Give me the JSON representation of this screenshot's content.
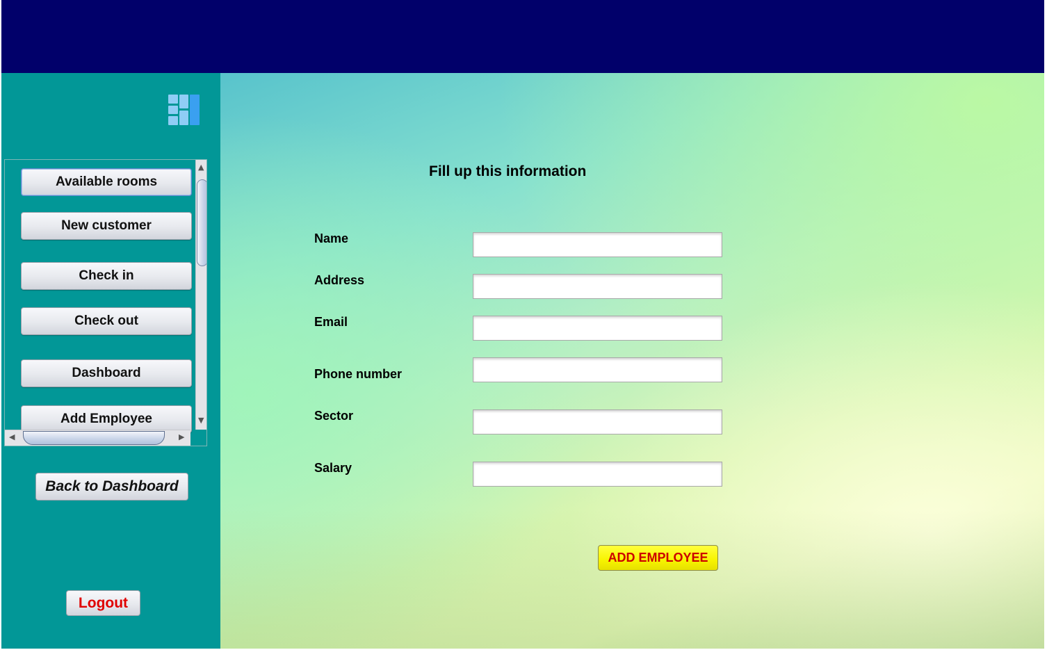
{
  "sidebar": {
    "logo_icon": "dashboard-grid-icon",
    "nav_items": [
      {
        "label": "Available rooms"
      },
      {
        "label": "New customer"
      },
      {
        "label": "Check in"
      },
      {
        "label": "Check out"
      },
      {
        "label": "Dashboard"
      },
      {
        "label": "Add Employee"
      }
    ],
    "back_label": "Back to Dashboard",
    "logout_label": "Logout"
  },
  "form": {
    "title": "Fill up this information",
    "fields": [
      {
        "label": "Name",
        "value": ""
      },
      {
        "label": "Address",
        "value": ""
      },
      {
        "label": "Email",
        "value": ""
      },
      {
        "label": "Phone number",
        "value": ""
      },
      {
        "label": "Sector",
        "value": ""
      },
      {
        "label": "Salary",
        "value": ""
      }
    ],
    "submit_label": "ADD EMPLOYEE"
  },
  "colors": {
    "topbar": "#01006a",
    "sidebar": "#029797",
    "logout_text": "#e00000",
    "submit_bg": "#f7f400",
    "submit_text": "#cc0000"
  }
}
